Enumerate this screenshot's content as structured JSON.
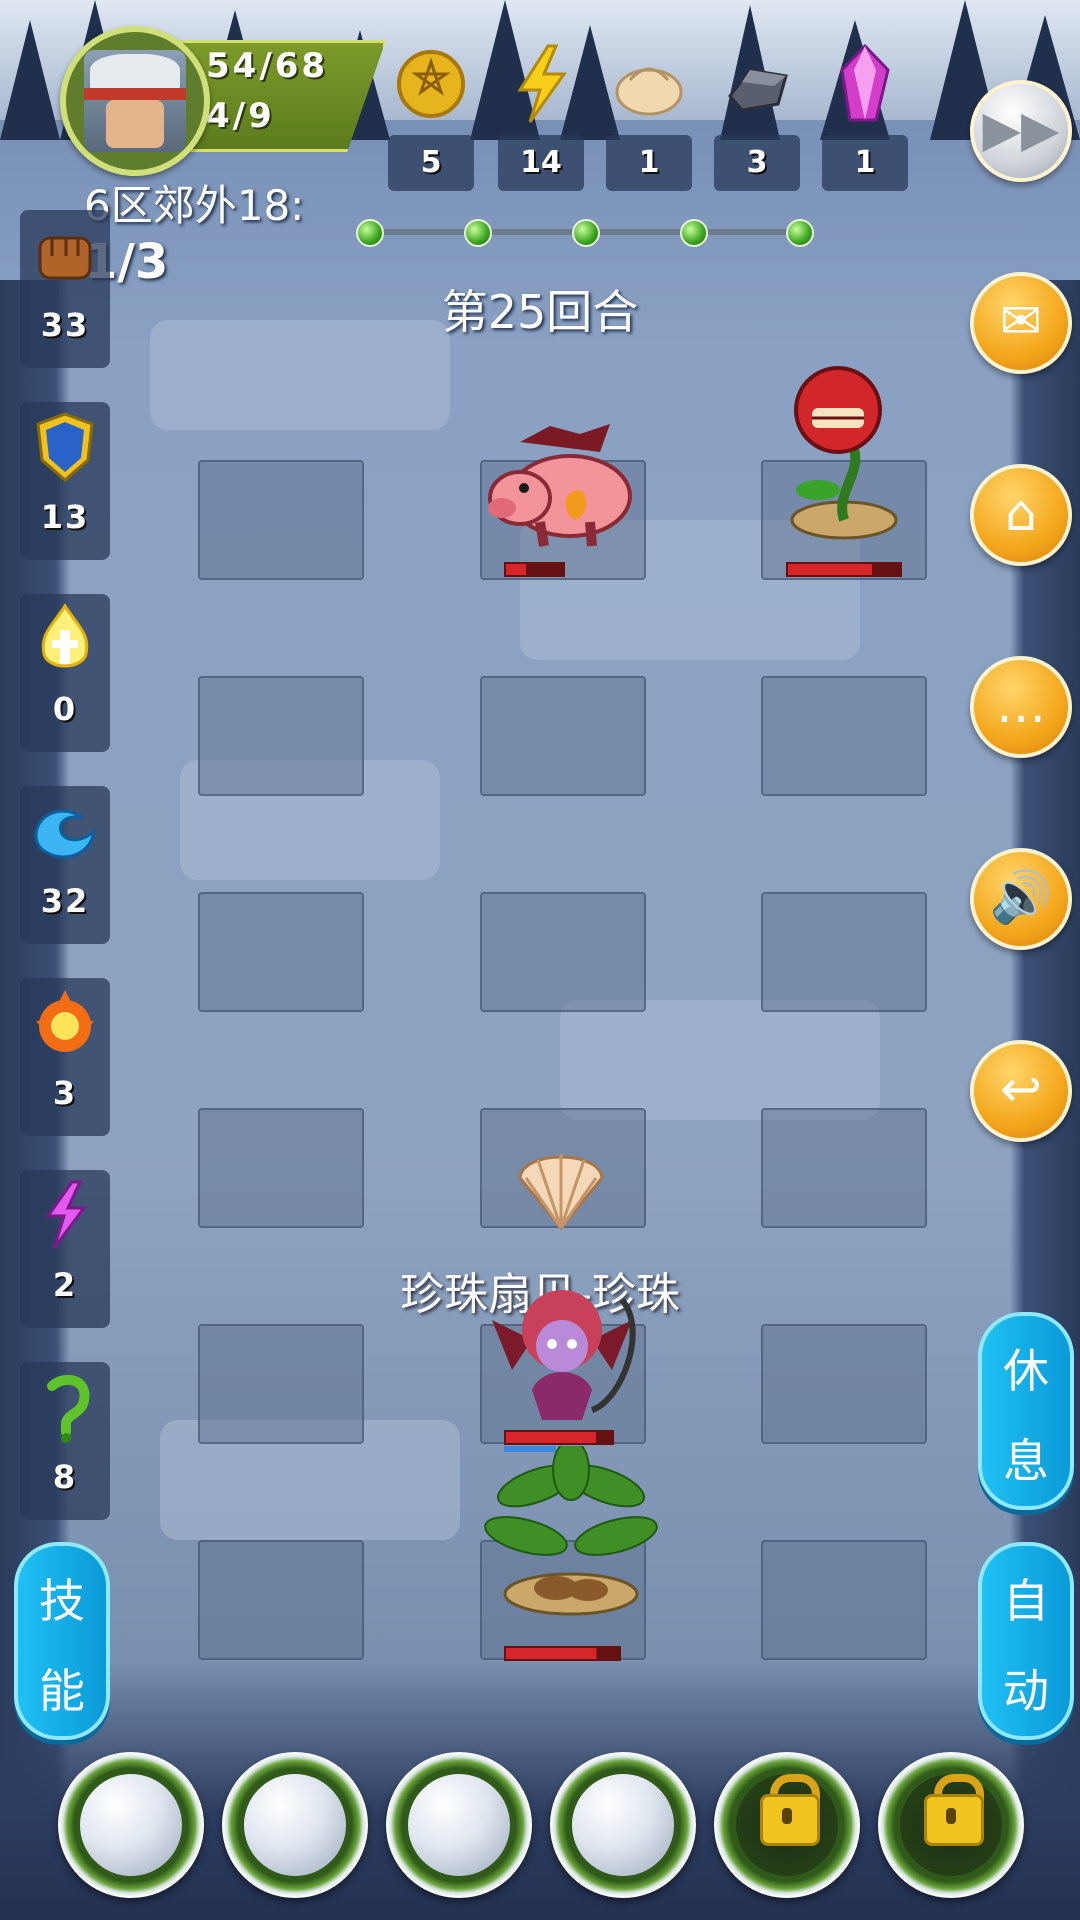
{
  "hud": {
    "hp": "54/68",
    "level_progress": "4/9",
    "resources": [
      {
        "name": "coin",
        "icon": "coin-icon",
        "value": "5"
      },
      {
        "name": "energy",
        "icon": "lightning-icon",
        "value": "14"
      },
      {
        "name": "dumpling",
        "icon": "dumpling-icon",
        "value": "1"
      },
      {
        "name": "iron",
        "icon": "iron-ingot-icon",
        "value": "3"
      },
      {
        "name": "crystal",
        "icon": "crystal-icon",
        "value": "1"
      }
    ]
  },
  "stage": {
    "zone_title": "6区郊外18:",
    "wave_progress": "1/3",
    "round_label": "第25回合",
    "progress_steps": 5
  },
  "left_stats": [
    {
      "icon": "fist-icon",
      "value": "33"
    },
    {
      "icon": "shield-icon",
      "value": "13"
    },
    {
      "icon": "holy-light-icon",
      "value": "0"
    },
    {
      "icon": "water-wave-icon",
      "value": "32"
    },
    {
      "icon": "fire-icon",
      "value": "3"
    },
    {
      "icon": "lightning-purple-icon",
      "value": "2"
    },
    {
      "icon": "poison-icon",
      "value": "8"
    }
  ],
  "right_buttons": [
    {
      "name": "fast-forward-button",
      "icon": "fast-forward-icon",
      "glyph": "▶▶"
    },
    {
      "name": "mail-button",
      "icon": "mail-icon",
      "glyph": "✉"
    },
    {
      "name": "home-button",
      "icon": "home-icon",
      "glyph": "⌂"
    },
    {
      "name": "chat-button",
      "icon": "chat-icon",
      "glyph": "…"
    },
    {
      "name": "sound-button",
      "icon": "speaker-icon",
      "glyph": "🔊"
    },
    {
      "name": "return-button",
      "icon": "return-icon",
      "glyph": "↩"
    }
  ],
  "units": {
    "pearl_scallop_label": "珍珠扇贝-珍珠"
  },
  "side_buttons": {
    "skill": [
      "技",
      "能"
    ],
    "rest": [
      "休",
      "息"
    ],
    "auto": [
      "自",
      "动"
    ]
  },
  "skill_slots": [
    {
      "state": "empty"
    },
    {
      "state": "empty"
    },
    {
      "state": "empty"
    },
    {
      "state": "empty"
    },
    {
      "state": "locked"
    },
    {
      "state": "locked"
    }
  ],
  "hp_levels": {
    "boar": 0.35,
    "flower": 0.75,
    "demon": 0.85,
    "plant": 0.8
  }
}
